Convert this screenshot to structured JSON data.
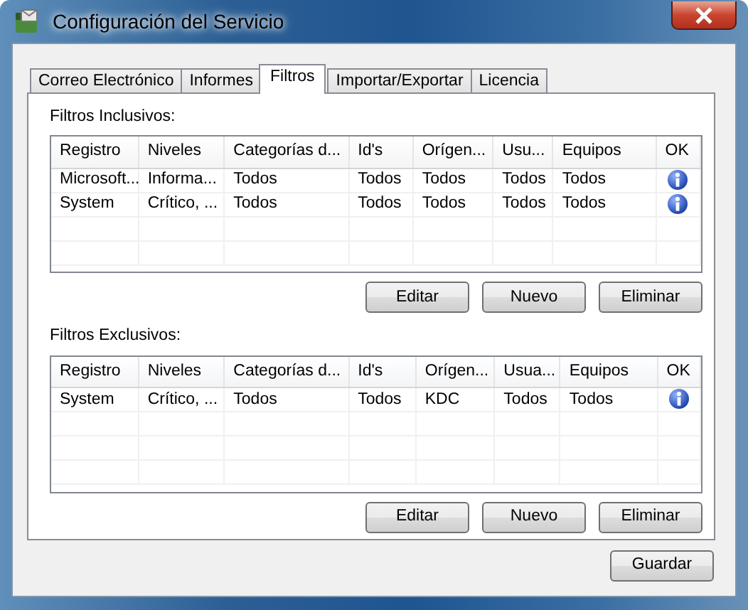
{
  "window": {
    "title": "Configuración del Servicio"
  },
  "tabs": [
    {
      "label": "Correo Electrónico",
      "selected": false
    },
    {
      "label": "Informes",
      "selected": false
    },
    {
      "label": "Filtros",
      "selected": true
    },
    {
      "label": "Importar/Exportar",
      "selected": false
    },
    {
      "label": "Licencia",
      "selected": false
    }
  ],
  "sections": [
    {
      "label": "Filtros Inclusivos:",
      "columns": [
        "Registro",
        "Niveles",
        "Categorías d...",
        "Id's",
        "Orígen...",
        "Usu...",
        "Equipos",
        "OK"
      ],
      "rows": [
        {
          "cells": [
            "Microsoft...",
            "Informa...",
            "Todos",
            "Todos",
            "Todos",
            "Todos",
            "Todos"
          ],
          "info_icon": true
        },
        {
          "cells": [
            "System",
            "Crítico, ...",
            "Todos",
            "Todos",
            "Todos",
            "Todos",
            "Todos"
          ],
          "info_icon": true
        }
      ],
      "buttons": [
        "Editar",
        "Nuevo",
        "Eliminar"
      ]
    },
    {
      "label": "Filtros Exclusivos:",
      "columns": [
        "Registro",
        "Niveles",
        "Categorías d...",
        "Id's",
        "Orígen...",
        "Usua...",
        "Equipos",
        "OK"
      ],
      "rows": [
        {
          "cells": [
            "System",
            "Crítico, ...",
            "Todos",
            "Todos",
            "KDC",
            "Todos",
            "Todos"
          ],
          "info_icon": true
        }
      ],
      "buttons": [
        "Editar",
        "Nuevo",
        "Eliminar"
      ]
    }
  ],
  "save_button": "Guardar"
}
